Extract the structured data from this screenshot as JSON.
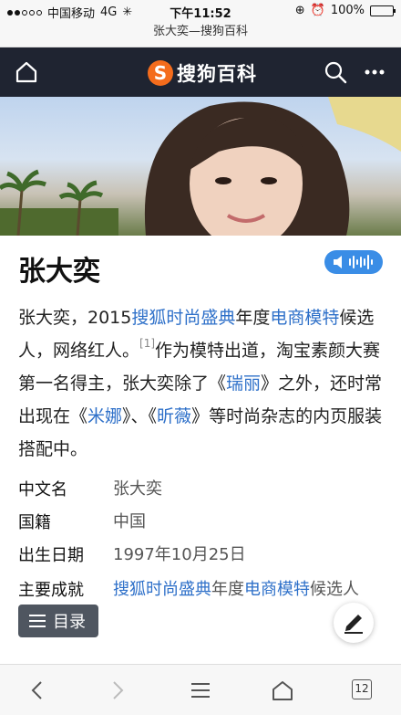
{
  "status_bar": {
    "carrier": "中国移动",
    "network": "4G",
    "time": "下午11:52",
    "battery_percent": "100%",
    "battery_color": "#3dc44a"
  },
  "url_bar": {
    "title": "张大奕—搜狗百科"
  },
  "header": {
    "logo_mark": "S",
    "logo_text": "搜狗百科",
    "icons": [
      "home-icon",
      "search-icon",
      "more-icon"
    ],
    "background": "#1f2431"
  },
  "article": {
    "title": "张大奕",
    "summary": {
      "p1": "张大奕，2015",
      "link1": "搜狐时尚盛典",
      "p2": "年度",
      "link2": "电商模特",
      "p3": "候选人，网络红人。",
      "ref": "[1]",
      "p4": "作为模特出道，淘宝素颜大赛第一名得主，张大奕除了《",
      "link3": "瑞丽",
      "p5": "》之外，还时常出现在《",
      "link4": "米娜",
      "p6": "》、《",
      "link5": "昕薇",
      "p7": "》等时尚杂志的内页服装搭配中。"
    },
    "info": [
      {
        "label": "中文名",
        "value": "张大奕"
      },
      {
        "label": "国籍",
        "value": "中国"
      },
      {
        "label": "出生日期",
        "value": "1997年10月25日"
      },
      {
        "label": "主要成就",
        "link1": "搜狐时尚盛典",
        "text1": "年度",
        "link2": "电商模特",
        "text2": "候选人"
      }
    ],
    "link_color": "#2e70c9"
  },
  "toc_button": {
    "label": "目录"
  },
  "toolbar": {
    "tab_count": "12"
  }
}
